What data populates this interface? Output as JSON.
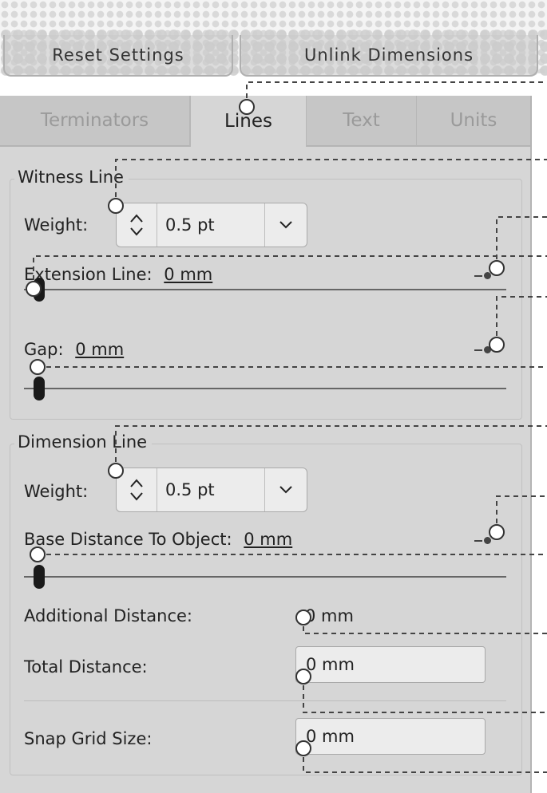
{
  "top_buttons": {
    "reset": "Reset Settings",
    "unlink": "Unlink Dimensions"
  },
  "tabs": [
    {
      "label": "Terminators",
      "active": false
    },
    {
      "label": "Lines",
      "active": true
    },
    {
      "label": "Text",
      "active": false
    },
    {
      "label": "Units",
      "active": false
    }
  ],
  "witness_line": {
    "title": "Witness Line",
    "weight_label": "Weight:",
    "weight_value": "0.5 pt",
    "extension_label": "Extension Line:",
    "extension_value": "0 mm",
    "extension_fraction": 0,
    "gap_label": "Gap:",
    "gap_value": "0 mm",
    "gap_fraction": 0
  },
  "dimension_line": {
    "title": "Dimension Line",
    "weight_label": "Weight:",
    "weight_value": "0.5 pt",
    "base_distance_label": "Base Distance To Object:",
    "base_distance_value": "0 mm",
    "base_distance_fraction": 0,
    "additional_label": "Additional Distance:",
    "additional_value": "0 mm",
    "total_label": "Total Distance:",
    "total_value": "0 mm",
    "snap_label": "Snap Grid Size:",
    "snap_value": "0 mm"
  },
  "colors": {
    "panel_bg": "#d6d6d6",
    "tab_inactive_bg": "#c6c6c6",
    "field_bg": "#ececec",
    "annotation_line": "#444444"
  }
}
